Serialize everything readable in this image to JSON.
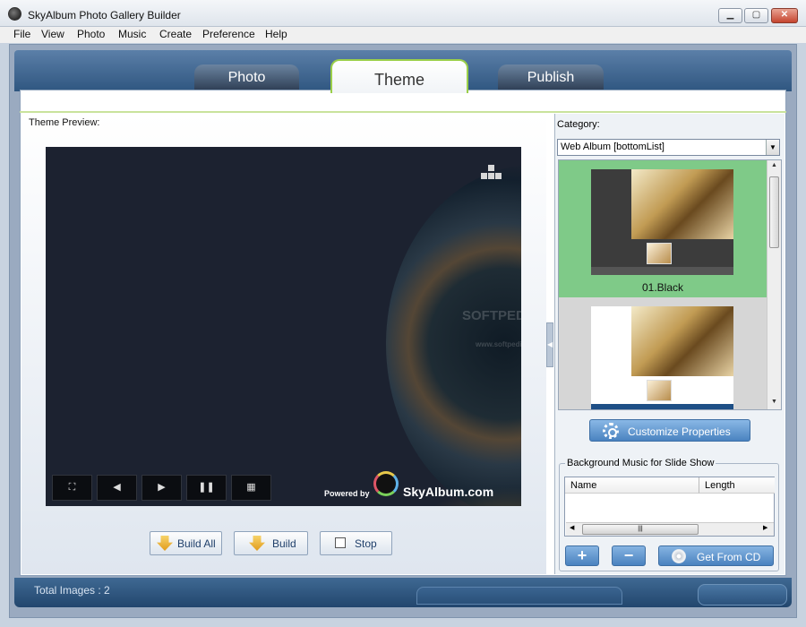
{
  "window": {
    "title": "SkyAlbum Photo Gallery Builder"
  },
  "menu": [
    "File",
    "View",
    "Photo",
    "Music",
    "Create",
    "Preference",
    "Help"
  ],
  "tabs": {
    "photo": "Photo",
    "theme": "Theme",
    "publish": "Publish"
  },
  "preview": {
    "label": "Theme Preview:",
    "powered_by": "Powered by",
    "brand": "SkyAlbum.com",
    "watermark": "SOFTPEDIA",
    "watermark_url": "www.softpedia.com"
  },
  "build": {
    "build_all": "Build All",
    "build": "Build",
    "stop": "Stop"
  },
  "category": {
    "label": "Category:",
    "selected": "Web Album [bottomList]"
  },
  "themes": [
    {
      "name": "01.Black"
    }
  ],
  "customize": "Customize Properties",
  "music": {
    "legend": "Background Music for Slide Show",
    "col_name": "Name",
    "col_length": "Length",
    "get_cd": "Get From CD"
  },
  "status": {
    "total": "Total Images : 2"
  }
}
